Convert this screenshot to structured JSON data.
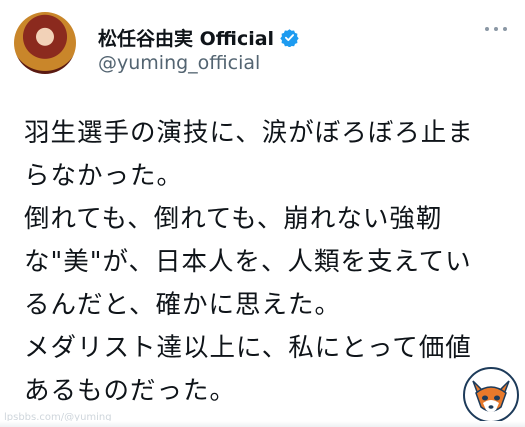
{
  "author": {
    "display_name": "松任谷由実 Official",
    "handle": "@yuming_official",
    "verified_icon": "verified-badge-icon"
  },
  "menu": {
    "icon": "more-options-icon"
  },
  "tweet": {
    "lines": [
      "羽生選手の演技に、涙がぼろぼろ止ま",
      "らなかった。",
      "倒れても、倒れても、崩れない強靭",
      "な\"美\"が、日本人を、人類を支えてい",
      "るんだと、確かに思えた。",
      "メダリスト達以上に、私にとって価値",
      "あるものだった。"
    ]
  },
  "overlay": {
    "watermark": "lpsbbs.com/@yuming",
    "logo_icon": "fox-logo-icon"
  },
  "colors": {
    "text": "#0f1419",
    "secondary": "#536471",
    "verified": "#1d9bf0",
    "fox_orange": "#e8792b"
  }
}
